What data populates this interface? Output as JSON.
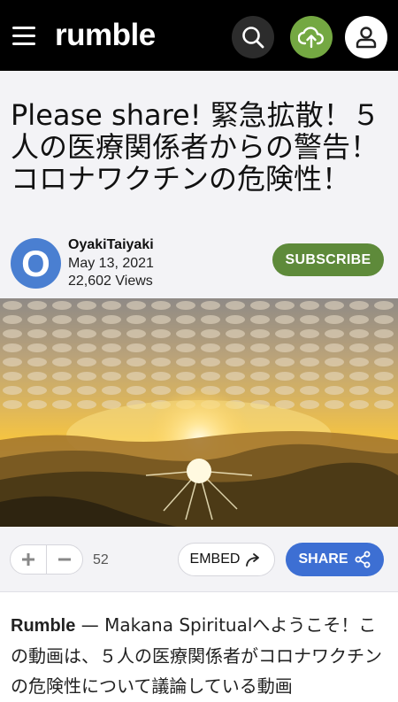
{
  "header": {
    "logo_text": "rumble",
    "menu_icon": "hamburger-menu-icon",
    "search_icon": "search-icon",
    "upload_icon": "cloud-upload-icon",
    "user_icon": "user-icon",
    "upload_color": "#74a842"
  },
  "video": {
    "title": "Please share! 緊急拡散！５人の医療関係者からの警告！コロナワクチンの危険性！",
    "channel": {
      "avatar_letter": "O",
      "name": "OyakiTaiyaki",
      "date": "May 13, 2021",
      "views": "22,602 Views",
      "avatar_color": "#4a7fd1"
    },
    "subscribe_label": "SUBSCRIBE",
    "subscribe_color": "#5e8a3a"
  },
  "actions": {
    "upvote_icon": "plus-icon",
    "downvote_icon": "minus-icon",
    "vote_count": "52",
    "embed_label": "EMBED",
    "share_label": "SHARE",
    "share_color": "#3d6fd3"
  },
  "description": {
    "source": "Rumble",
    "separator": " — ",
    "text": "Makana Spiritualへようこそ！この動画は、５人の医療関係者がコロナワクチンの危険性について議論している動画"
  }
}
